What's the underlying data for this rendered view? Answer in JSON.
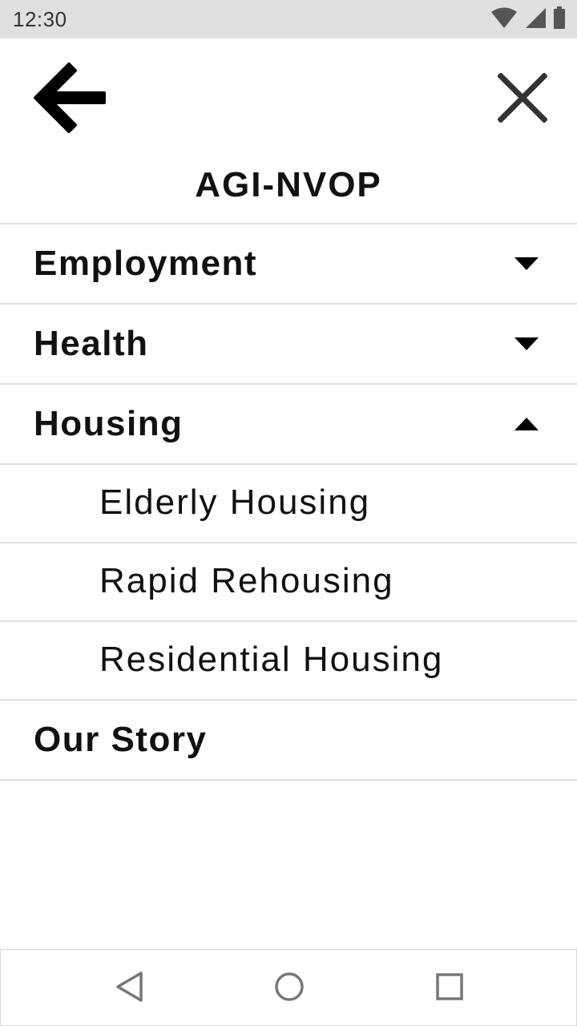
{
  "status_bar": {
    "time": "12:30",
    "icons": [
      "wifi-icon",
      "cell-signal-icon",
      "battery-icon"
    ]
  },
  "toolbar": {
    "back_icon": "arrow-left-icon",
    "close_icon": "close-icon"
  },
  "site": {
    "title": "AGI-NVOP"
  },
  "menu": {
    "items": [
      {
        "label": "Employment",
        "state": "collapsed"
      },
      {
        "label": "Health",
        "state": "collapsed"
      },
      {
        "label": "Housing",
        "state": "expanded",
        "children": [
          {
            "label": "Elderly Housing"
          },
          {
            "label": "Rapid Rehousing"
          },
          {
            "label": "Residential Housing"
          }
        ]
      },
      {
        "label": "Our Story"
      }
    ]
  },
  "nav_bar": {
    "icons": [
      "back-triangle-icon",
      "home-circle-icon",
      "recents-square-icon"
    ]
  },
  "colors": {
    "status_bar_bg": "#e0e0e0",
    "divider": "#e0e0e0",
    "text": "#111111"
  }
}
